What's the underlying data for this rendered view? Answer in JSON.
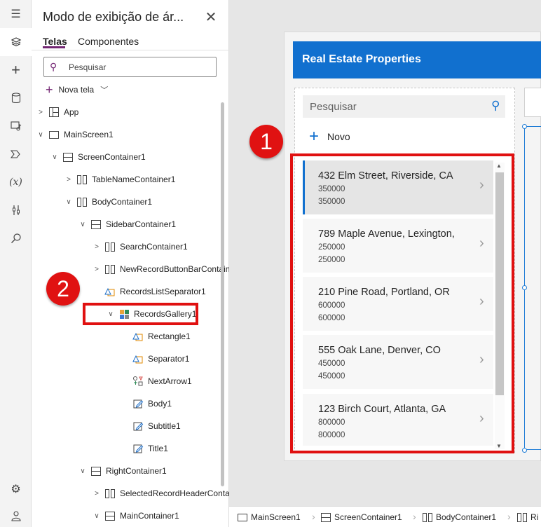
{
  "rail": {
    "icons": [
      "hamburger-icon",
      "layers-icon",
      "plus-icon",
      "database-icon",
      "media-icon",
      "flow-icon",
      "variable-icon",
      "tools-icon",
      "search-icon",
      "settings-icon",
      "account-icon"
    ],
    "variable_label": "(x)"
  },
  "tree": {
    "title": "Modo de exibição de ár...",
    "tabs": [
      "Telas",
      "Componentes"
    ],
    "search_placeholder": "Pesquisar",
    "new_screen": "Nova tela",
    "nodes": [
      {
        "label": "App"
      },
      {
        "label": "MainScreen1"
      },
      {
        "label": "ScreenContainer1"
      },
      {
        "label": "TableNameContainer1"
      },
      {
        "label": "BodyContainer1"
      },
      {
        "label": "SidebarContainer1"
      },
      {
        "label": "SearchContainer1"
      },
      {
        "label": "NewRecordButtonBarContain"
      },
      {
        "label": "RecordsListSeparator1"
      },
      {
        "label": "RecordsGallery1"
      },
      {
        "label": "Rectangle1"
      },
      {
        "label": "Separator1"
      },
      {
        "label": "NextArrow1"
      },
      {
        "label": "Body1"
      },
      {
        "label": "Subtitle1"
      },
      {
        "label": "Title1"
      },
      {
        "label": "RightContainer1"
      },
      {
        "label": "SelectedRecordHeaderConta"
      },
      {
        "label": "MainContainer1"
      }
    ]
  },
  "callouts": {
    "one": "1",
    "two": "2",
    "color": "#e01010"
  },
  "app": {
    "header_title": "Real Estate Properties",
    "search_placeholder": "Pesquisar",
    "new_label": "Novo",
    "accent": "#1170cf",
    "records": [
      {
        "title": "432 Elm Street, Riverside, CA",
        "subtitle": "350000",
        "body": "350000"
      },
      {
        "title": "789 Maple Avenue, Lexington,",
        "subtitle": "250000",
        "body": "250000"
      },
      {
        "title": "210 Pine Road, Portland, OR",
        "subtitle": "600000",
        "body": "600000"
      },
      {
        "title": "555 Oak Lane, Denver, CO",
        "subtitle": "450000",
        "body": "450000"
      },
      {
        "title": "123 Birch Court, Atlanta, GA",
        "subtitle": "800000",
        "body": "800000"
      }
    ]
  },
  "breadcrumbs": [
    "MainScreen1",
    "ScreenContainer1",
    "BodyContainer1",
    "Ri"
  ]
}
